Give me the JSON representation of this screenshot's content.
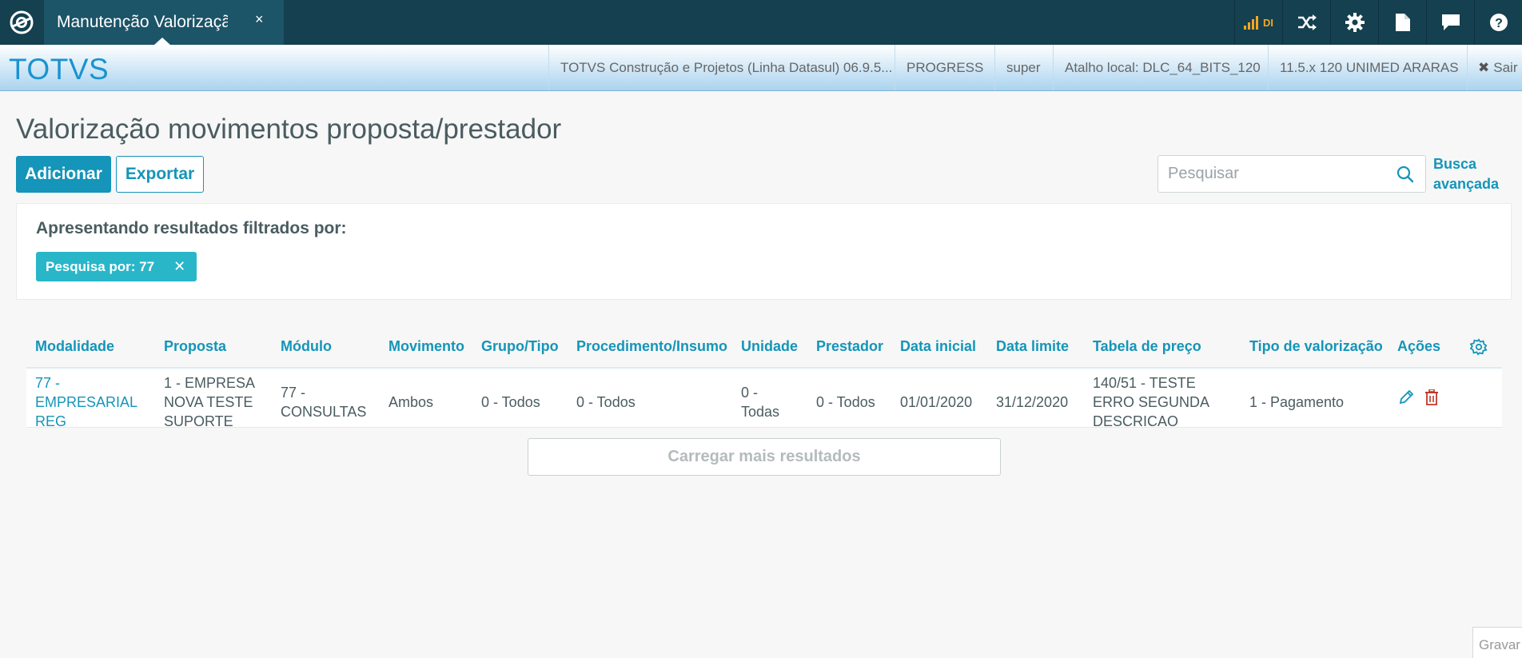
{
  "tab": {
    "label": "Manutenção Valorizaçã",
    "close": "×"
  },
  "top_icons": [
    "signal-icon",
    "shuffle-icon",
    "gear-icon",
    "document-icon",
    "chat-icon",
    "help-icon"
  ],
  "signal_label": "DI",
  "brand": "TOTVS",
  "info_items": [
    "TOTVS Construção e Projetos (Linha Datasul) 06.9.5...",
    "PROGRESS",
    "super",
    "Atalho local: DLC_64_BITS_120",
    "11.5.x 120 UNIMED ARARAS"
  ],
  "exit_label": "Sair",
  "page_title": "Valorização movimentos proposta/prestador",
  "buttons": {
    "add": "Adicionar",
    "export": "Exportar"
  },
  "search": {
    "placeholder": "Pesquisar",
    "advanced": "Busca avançada"
  },
  "filter": {
    "title": "Apresentando resultados filtrados por:",
    "chip": "Pesquisa por: 77"
  },
  "table": {
    "columns": [
      "Modalidade",
      "Proposta",
      "Módulo",
      "Movimento",
      "Grupo/Tipo",
      "Procedimento/Insumo",
      "Unidade",
      "Prestador",
      "Data inicial",
      "Data limite",
      "Tabela de preço",
      "Tipo de valorização",
      "Ações"
    ],
    "rows": [
      {
        "modalidade": [
          "77 -",
          "EMPRESARIAL",
          "REG"
        ],
        "proposta": [
          "1 - EMPRESA",
          "NOVA TESTE",
          "SUPORTE"
        ],
        "modulo": [
          "77 -",
          "CONSULTAS"
        ],
        "movimento": "Ambos",
        "grupo": "0 - Todos",
        "procedimento": "0 - Todos",
        "unidade": [
          "0 -",
          "Todas"
        ],
        "prestador": "0 - Todos",
        "data_inicial": "01/01/2020",
        "data_limite": "31/12/2020",
        "tabela": [
          "140/51 - TESTE",
          "ERRO SEGUNDA",
          "DESCRICAO"
        ],
        "tipo": "1 - Pagamento"
      }
    ]
  },
  "load_more": "Carregar mais resultados",
  "save_label": "Gravar",
  "colors": {
    "topbar": "#14404f",
    "accent": "#1495b9",
    "chip": "#29b6c8",
    "delete": "#c0392b"
  }
}
